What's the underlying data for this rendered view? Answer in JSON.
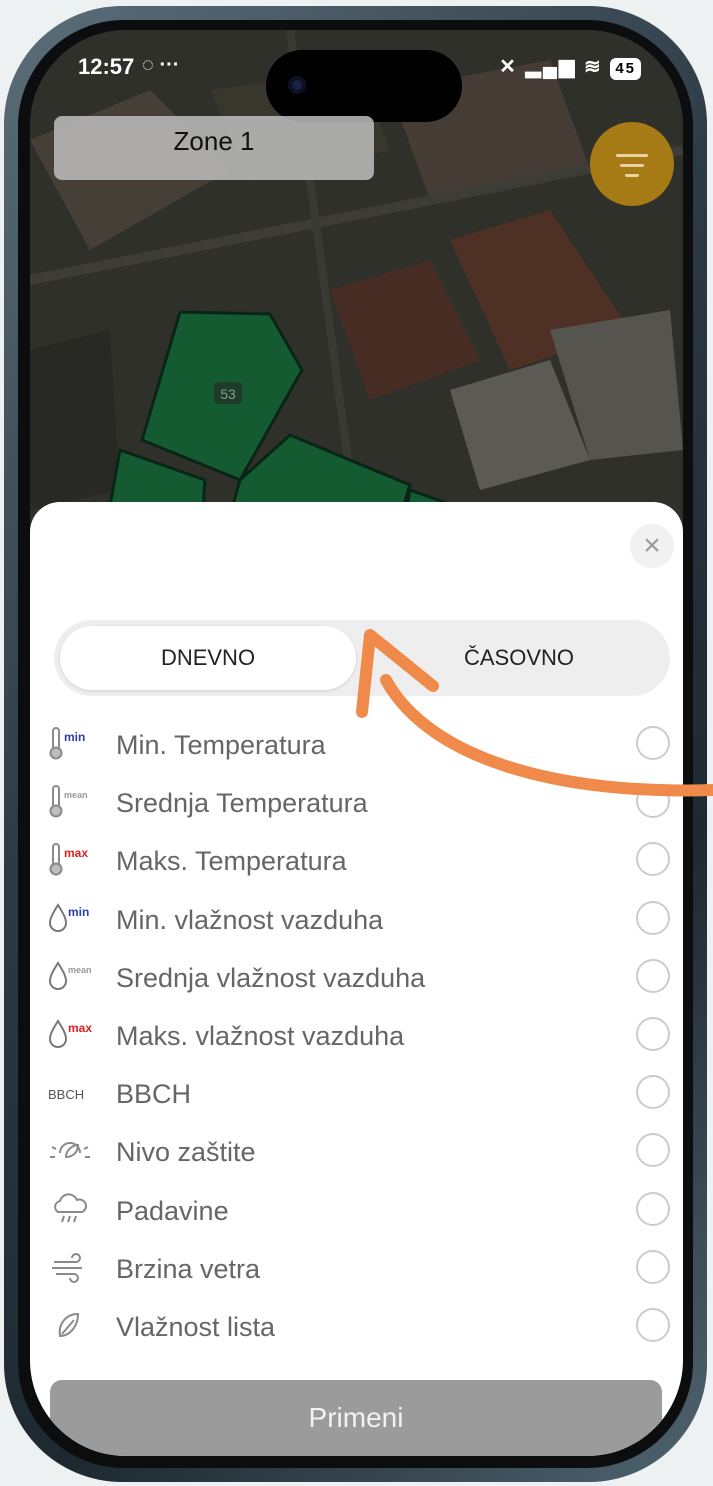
{
  "status_bar": {
    "time": "12:57",
    "battery": "45"
  },
  "map": {
    "zone_label": "Zone 1",
    "parcel_label": "53"
  },
  "sheet": {
    "tabs": [
      {
        "label": "DNEVNO",
        "selected": true
      },
      {
        "label": "ČASOVNO",
        "selected": false
      }
    ],
    "items": [
      {
        "icon": "thermometer-min-icon",
        "tag": "min",
        "label": "Min. Temperatura"
      },
      {
        "icon": "thermometer-mean-icon",
        "tag": "mean",
        "label": "Srednja Temperatura"
      },
      {
        "icon": "thermometer-max-icon",
        "tag": "max",
        "label": "Maks. Temperatura"
      },
      {
        "icon": "droplet-min-icon",
        "tag": "min",
        "label": "Min. vlažnost vazduha"
      },
      {
        "icon": "droplet-mean-icon",
        "tag": "mean",
        "label": "Srednja vlažnost vazduha"
      },
      {
        "icon": "droplet-max-icon",
        "tag": "max",
        "label": "Maks. vlažnost vazduha"
      },
      {
        "icon": "bbch-icon",
        "tag": "BBCH",
        "label": "BBCH"
      },
      {
        "icon": "protection-level-icon",
        "tag": "",
        "label": "Nivo zaštite"
      },
      {
        "icon": "rain-cloud-icon",
        "tag": "",
        "label": "Padavine"
      },
      {
        "icon": "wind-icon",
        "tag": "",
        "label": "Brzina vetra"
      },
      {
        "icon": "leaf-wetness-icon",
        "tag": "",
        "label": "Vlažnost lista"
      }
    ],
    "apply_label": "Primeni"
  },
  "colors": {
    "accent_arrow": "#F08A4B",
    "fab": "#A67A14",
    "parcel_green": "#1E8A4C"
  }
}
